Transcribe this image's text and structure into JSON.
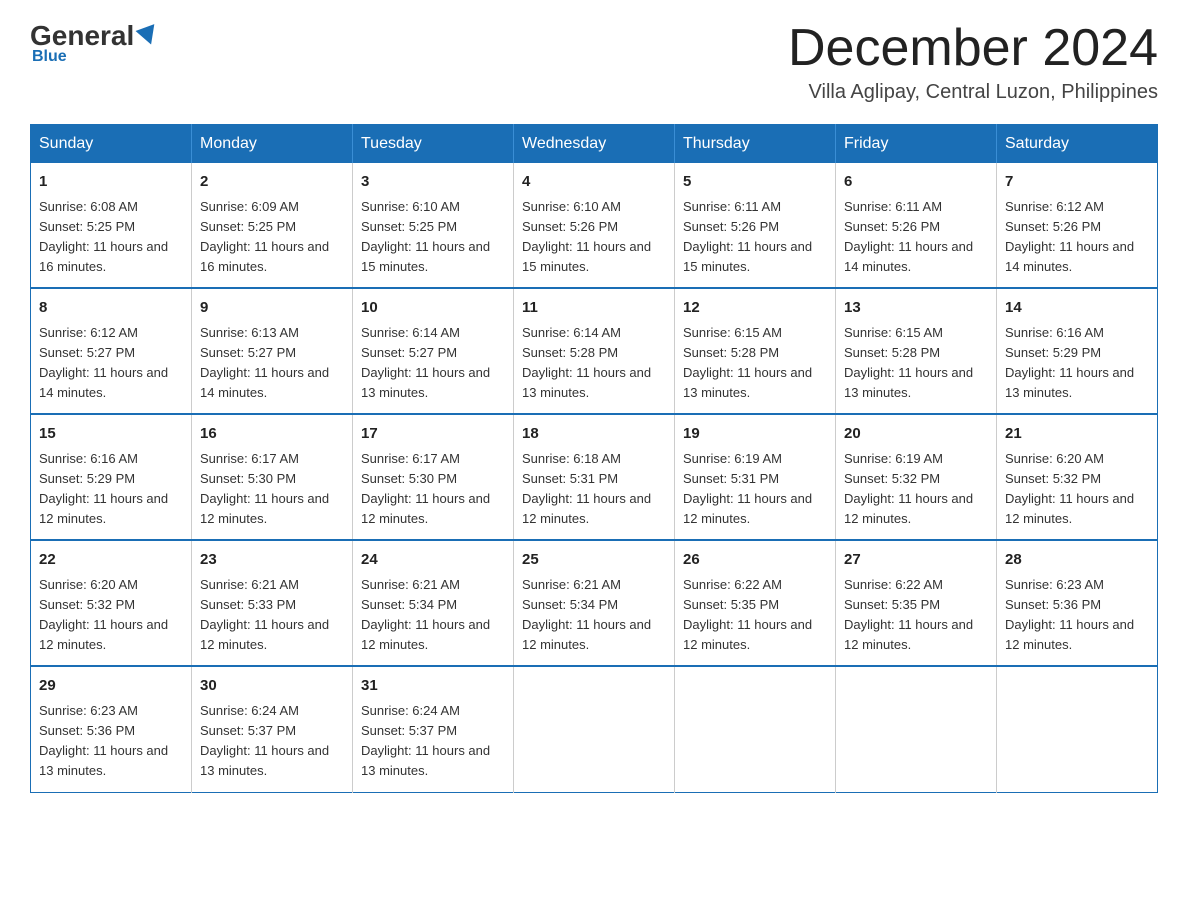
{
  "logo": {
    "general": "General",
    "blue": "Blue",
    "underline": "Blue"
  },
  "header": {
    "month_title": "December 2024",
    "location": "Villa Aglipay, Central Luzon, Philippines"
  },
  "days_of_week": [
    "Sunday",
    "Monday",
    "Tuesday",
    "Wednesday",
    "Thursday",
    "Friday",
    "Saturday"
  ],
  "weeks": [
    {
      "days": [
        {
          "num": "1",
          "sunrise": "6:08 AM",
          "sunset": "5:25 PM",
          "daylight": "11 hours and 16 minutes."
        },
        {
          "num": "2",
          "sunrise": "6:09 AM",
          "sunset": "5:25 PM",
          "daylight": "11 hours and 16 minutes."
        },
        {
          "num": "3",
          "sunrise": "6:10 AM",
          "sunset": "5:25 PM",
          "daylight": "11 hours and 15 minutes."
        },
        {
          "num": "4",
          "sunrise": "6:10 AM",
          "sunset": "5:26 PM",
          "daylight": "11 hours and 15 minutes."
        },
        {
          "num": "5",
          "sunrise": "6:11 AM",
          "sunset": "5:26 PM",
          "daylight": "11 hours and 15 minutes."
        },
        {
          "num": "6",
          "sunrise": "6:11 AM",
          "sunset": "5:26 PM",
          "daylight": "11 hours and 14 minutes."
        },
        {
          "num": "7",
          "sunrise": "6:12 AM",
          "sunset": "5:26 PM",
          "daylight": "11 hours and 14 minutes."
        }
      ]
    },
    {
      "days": [
        {
          "num": "8",
          "sunrise": "6:12 AM",
          "sunset": "5:27 PM",
          "daylight": "11 hours and 14 minutes."
        },
        {
          "num": "9",
          "sunrise": "6:13 AM",
          "sunset": "5:27 PM",
          "daylight": "11 hours and 14 minutes."
        },
        {
          "num": "10",
          "sunrise": "6:14 AM",
          "sunset": "5:27 PM",
          "daylight": "11 hours and 13 minutes."
        },
        {
          "num": "11",
          "sunrise": "6:14 AM",
          "sunset": "5:28 PM",
          "daylight": "11 hours and 13 minutes."
        },
        {
          "num": "12",
          "sunrise": "6:15 AM",
          "sunset": "5:28 PM",
          "daylight": "11 hours and 13 minutes."
        },
        {
          "num": "13",
          "sunrise": "6:15 AM",
          "sunset": "5:28 PM",
          "daylight": "11 hours and 13 minutes."
        },
        {
          "num": "14",
          "sunrise": "6:16 AM",
          "sunset": "5:29 PM",
          "daylight": "11 hours and 13 minutes."
        }
      ]
    },
    {
      "days": [
        {
          "num": "15",
          "sunrise": "6:16 AM",
          "sunset": "5:29 PM",
          "daylight": "11 hours and 12 minutes."
        },
        {
          "num": "16",
          "sunrise": "6:17 AM",
          "sunset": "5:30 PM",
          "daylight": "11 hours and 12 minutes."
        },
        {
          "num": "17",
          "sunrise": "6:17 AM",
          "sunset": "5:30 PM",
          "daylight": "11 hours and 12 minutes."
        },
        {
          "num": "18",
          "sunrise": "6:18 AM",
          "sunset": "5:31 PM",
          "daylight": "11 hours and 12 minutes."
        },
        {
          "num": "19",
          "sunrise": "6:19 AM",
          "sunset": "5:31 PM",
          "daylight": "11 hours and 12 minutes."
        },
        {
          "num": "20",
          "sunrise": "6:19 AM",
          "sunset": "5:32 PM",
          "daylight": "11 hours and 12 minutes."
        },
        {
          "num": "21",
          "sunrise": "6:20 AM",
          "sunset": "5:32 PM",
          "daylight": "11 hours and 12 minutes."
        }
      ]
    },
    {
      "days": [
        {
          "num": "22",
          "sunrise": "6:20 AM",
          "sunset": "5:32 PM",
          "daylight": "11 hours and 12 minutes."
        },
        {
          "num": "23",
          "sunrise": "6:21 AM",
          "sunset": "5:33 PM",
          "daylight": "11 hours and 12 minutes."
        },
        {
          "num": "24",
          "sunrise": "6:21 AM",
          "sunset": "5:34 PM",
          "daylight": "11 hours and 12 minutes."
        },
        {
          "num": "25",
          "sunrise": "6:21 AM",
          "sunset": "5:34 PM",
          "daylight": "11 hours and 12 minutes."
        },
        {
          "num": "26",
          "sunrise": "6:22 AM",
          "sunset": "5:35 PM",
          "daylight": "11 hours and 12 minutes."
        },
        {
          "num": "27",
          "sunrise": "6:22 AM",
          "sunset": "5:35 PM",
          "daylight": "11 hours and 12 minutes."
        },
        {
          "num": "28",
          "sunrise": "6:23 AM",
          "sunset": "5:36 PM",
          "daylight": "11 hours and 12 minutes."
        }
      ]
    },
    {
      "days": [
        {
          "num": "29",
          "sunrise": "6:23 AM",
          "sunset": "5:36 PM",
          "daylight": "11 hours and 13 minutes."
        },
        {
          "num": "30",
          "sunrise": "6:24 AM",
          "sunset": "5:37 PM",
          "daylight": "11 hours and 13 minutes."
        },
        {
          "num": "31",
          "sunrise": "6:24 AM",
          "sunset": "5:37 PM",
          "daylight": "11 hours and 13 minutes."
        },
        null,
        null,
        null,
        null
      ]
    }
  ]
}
